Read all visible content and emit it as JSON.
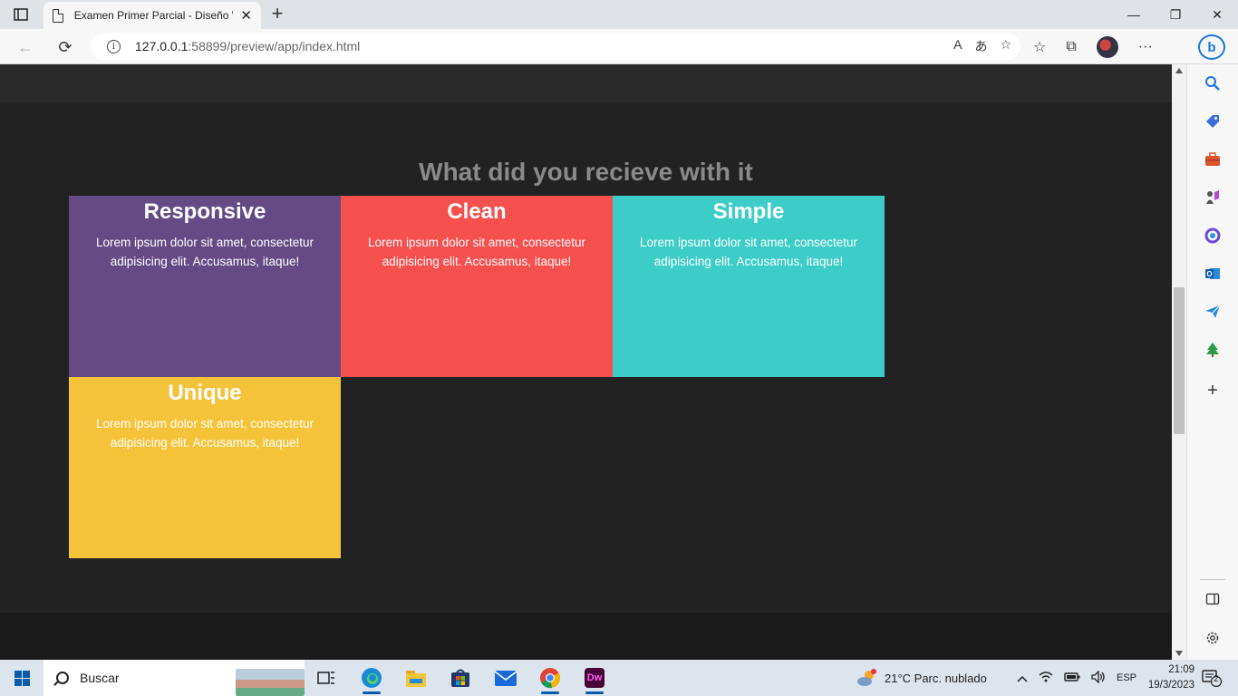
{
  "browser": {
    "tab_title": "Examen Primer Parcial - Diseño W",
    "tab_close": "✕",
    "new_tab": "+",
    "url_host": "127.0.0.1",
    "url_rest": ":58899/preview/app/index.html",
    "win_minimize": "—",
    "win_restore": "❐",
    "win_close": "✕",
    "back": "←",
    "reload": "⟳",
    "read_aloud": "A",
    "translate": "あ",
    "favorite_add": "☆",
    "favorites": "☆",
    "collections": "⧉",
    "more": "···",
    "bing": "b"
  },
  "page": {
    "section_title": "What did you recieve with it",
    "cards": [
      {
        "title": "Responsive",
        "text": "Lorem ipsum dolor sit amet, consectetur adipisicing elit. Accusamus, itaque!",
        "color": "#654A86"
      },
      {
        "title": "Clean",
        "text": "Lorem ipsum dolor sit amet, consectetur adipisicing elit. Accusamus, itaque!",
        "color": "#F54F4E"
      },
      {
        "title": "Simple",
        "text": "Lorem ipsum dolor sit amet, consectetur adipisicing elit. Accusamus, itaque!",
        "color": "#3CCDC8"
      },
      {
        "title": "Unique",
        "text": "Lorem ipsum dolor sit amet, consectetur adipisicing elit. Accusamus, itaque!",
        "color": "#F5C33A"
      }
    ]
  },
  "taskbar": {
    "search_text": "Buscar",
    "weather": "21°C  Parc. nublado",
    "language": "ESP",
    "time": "21:09",
    "date": "19/3/2023",
    "notifications": "2",
    "dw_label": "Dw"
  }
}
